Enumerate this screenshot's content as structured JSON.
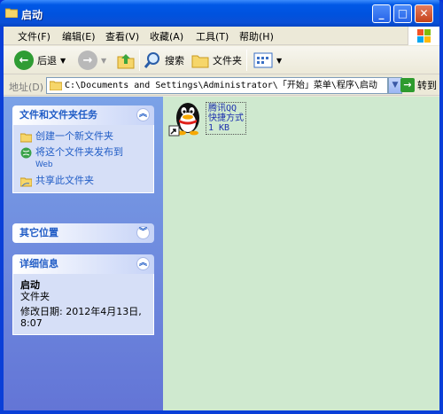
{
  "window": {
    "title": "启动",
    "close": "✕",
    "maximize": "□",
    "minimize": "_"
  },
  "menu": [
    "文件(F)",
    "编辑(E)",
    "查看(V)",
    "收藏(A)",
    "工具(T)",
    "帮助(H)"
  ],
  "toolbar": {
    "back": "后退",
    "search": "搜索",
    "folders": "文件夹"
  },
  "address": {
    "label": "地址(D)",
    "value": "C:\\Documents and Settings\\Administrator\\「开始」菜单\\程序\\启动",
    "go": "转到"
  },
  "tasks": {
    "title": "文件和文件夹任务",
    "items": [
      "创建一个新文件夹",
      "将这个文件夹发布到",
      "Web",
      "共享此文件夹"
    ]
  },
  "other": {
    "title": "其它位置"
  },
  "details": {
    "title": "详细信息",
    "name": "启动",
    "type": "文件夹",
    "modified": "修改日期: 2012年4月13日,",
    "time": "8:07"
  },
  "file": {
    "name": "腾讯QQ",
    "type": "快捷方式",
    "size": "1 KB"
  }
}
